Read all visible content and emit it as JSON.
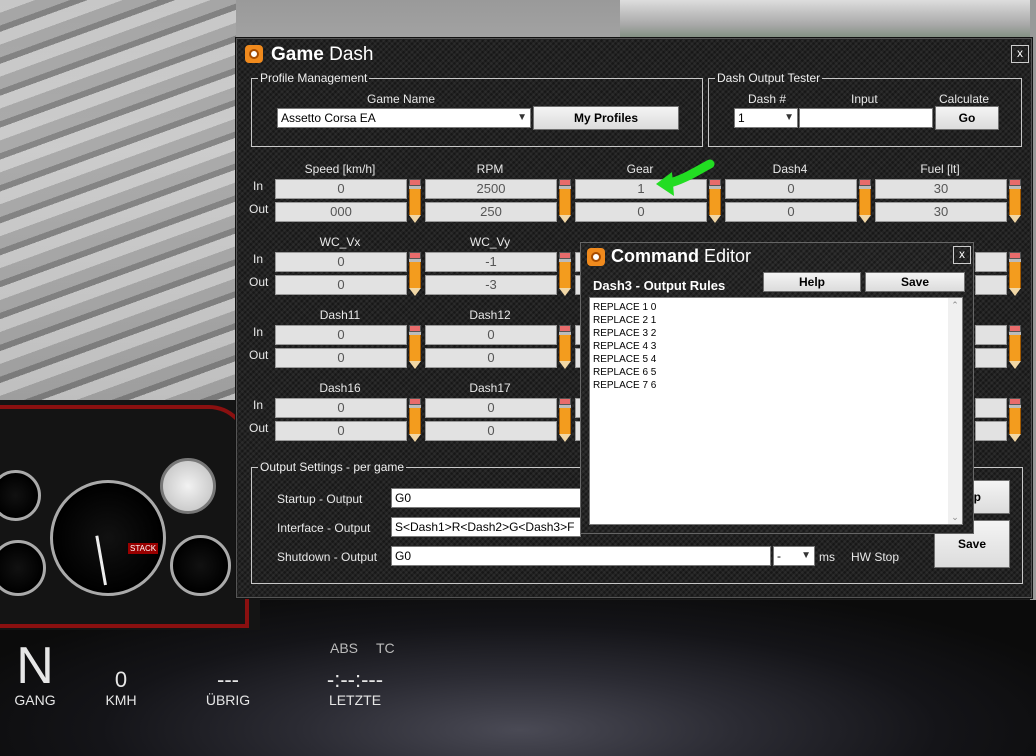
{
  "colors": {
    "accent_orange": "#f08a1d",
    "arrow_green": "#22dd22",
    "window_bg": "#232323"
  },
  "main_window": {
    "title_bold": "Game",
    "title_rest": " Dash",
    "close": "x",
    "profile_management": {
      "legend": "Profile Management",
      "game_name_label": "Game Name",
      "game_name_value": "Assetto Corsa EA",
      "my_profiles_button": "My Profiles"
    },
    "dash_output_tester": {
      "legend": "Dash Output Tester",
      "dash_num_label": "Dash #",
      "dash_num_value": "1",
      "input_label": "Input",
      "input_value": "",
      "calculate_label": "Calculate",
      "go_button": "Go"
    },
    "row_labels": {
      "in": "In",
      "out": "Out"
    },
    "channels_row1": [
      {
        "name": "Speed [km/h]",
        "in": "0",
        "out": "000"
      },
      {
        "name": "RPM",
        "in": "2500",
        "out": "250"
      },
      {
        "name": "Gear",
        "in": "1",
        "out": "0"
      },
      {
        "name": "Dash4",
        "in": "0",
        "out": "0"
      },
      {
        "name": "Fuel [lt]",
        "in": "30",
        "out": "30"
      }
    ],
    "channels_row2": [
      {
        "name": "WC_Vx",
        "in": "0",
        "out": "0"
      },
      {
        "name": "WC_Vy",
        "in": "-1",
        "out": "-3"
      }
    ],
    "channels_row3": [
      {
        "name": "Dash11",
        "in": "0",
        "out": "0"
      },
      {
        "name": "Dash12",
        "in": "0",
        "out": "0"
      }
    ],
    "channels_row4": [
      {
        "name": "Dash16",
        "in": "0",
        "out": "0"
      },
      {
        "name": "Dash17",
        "in": "0",
        "out": "0"
      }
    ],
    "output_settings": {
      "legend": "Output Settings - per game",
      "startup_label": "Startup - Output",
      "startup_value": "G0",
      "interface_label": "Interface - Output",
      "interface_value": "S<Dash1>R<Dash2>G<Dash3>F",
      "shutdown_label": "Shutdown - Output",
      "shutdown_value": "G0",
      "ms_select_value": "-",
      "ms_label": "ms",
      "hw_stop_label": "HW Stop",
      "partial_button": "p",
      "save_button": "Save"
    }
  },
  "command_editor": {
    "title_bold": "Command",
    "title_rest": " Editor",
    "close": "x",
    "subtitle": "Dash3 - Output Rules",
    "help_button": "Help",
    "save_button": "Save",
    "rules": [
      "REPLACE 1 0",
      "REPLACE 2 1",
      "REPLACE 3 2",
      "REPLACE 4 3",
      "REPLACE 5 4",
      "REPLACE 6 5",
      "REPLACE 7 6"
    ]
  },
  "hud": {
    "gear_value": "N",
    "gear_label": "GANG",
    "speed_value": "0",
    "speed_label": "KMH",
    "remaining_value": "---",
    "remaining_label": "ÜBRIG",
    "last_value": "-:--:---",
    "last_label": "LETZTE",
    "abs_label": "ABS",
    "tc_label": "TC"
  }
}
